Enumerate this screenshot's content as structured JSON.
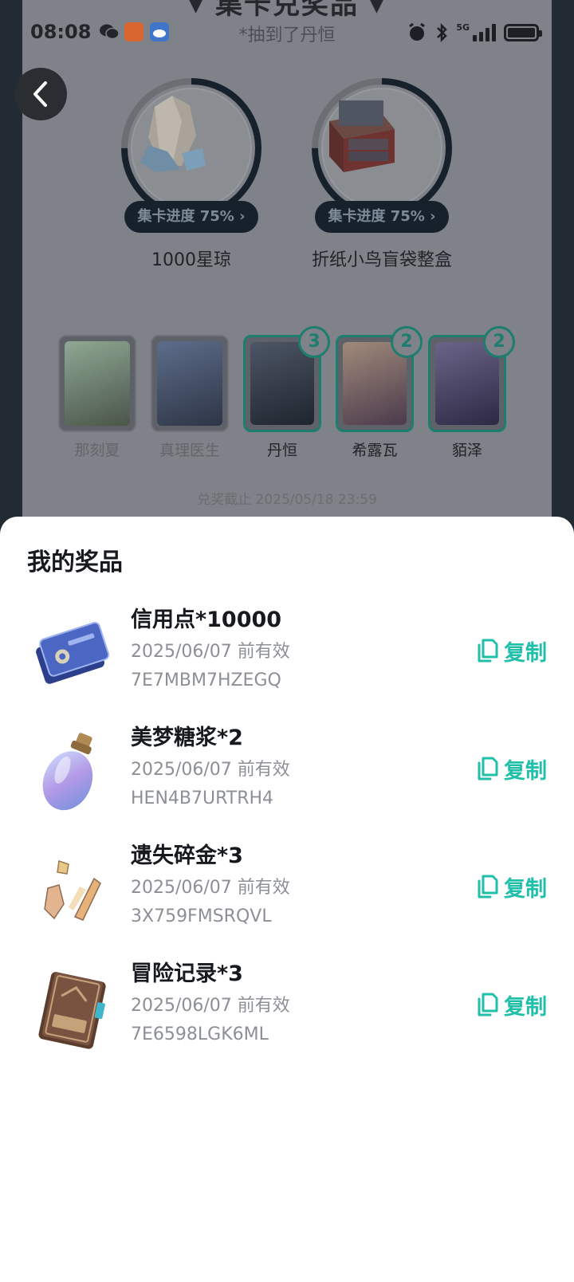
{
  "status_bar": {
    "time": "08:08",
    "notice": "*抽到了丹恒",
    "network": "5G"
  },
  "background": {
    "header_title": "集卡兑奖品",
    "prizes": [
      {
        "name": "1000星琼",
        "progress_label": "集卡进度 75%",
        "progress": 0.75
      },
      {
        "name": "折纸小鸟盲袋整盒",
        "progress_label": "集卡进度 75%",
        "progress": 0.75
      }
    ],
    "characters": [
      {
        "name": "那刻夏",
        "owned": false,
        "count": "",
        "color": "#6f8a78"
      },
      {
        "name": "真理医生",
        "owned": false,
        "count": "",
        "color": "#4a5c78"
      },
      {
        "name": "丹恒",
        "owned": true,
        "count": "3",
        "color": "#3a4453"
      },
      {
        "name": "希露瓦",
        "owned": true,
        "count": "2",
        "color": "#8a6d74"
      },
      {
        "name": "貊泽",
        "owned": true,
        "count": "2",
        "color": "#4c4a6e"
      }
    ],
    "deadline": "兑奖截止 2025/05/18 23:59"
  },
  "sheet": {
    "title": "我的奖品",
    "copy_label": "复制",
    "items": [
      {
        "title": "信用点*10000",
        "valid": "2025/06/07 前有效",
        "code": "7E7MBM7HZEGQ",
        "icon": "credit-card-icon"
      },
      {
        "title": "美梦糖浆*2",
        "valid": "2025/06/07 前有效",
        "code": "HEN4B7URTRH4",
        "icon": "syrup-bottle-icon"
      },
      {
        "title": "遗失碎金*3",
        "valid": "2025/06/07 前有效",
        "code": "3X759FMSRQVL",
        "icon": "gold-shards-icon"
      },
      {
        "title": "冒险记录*3",
        "valid": "2025/06/07 前有效",
        "code": "7E6598LGK6ML",
        "icon": "adventure-book-icon"
      }
    ]
  },
  "colors": {
    "accent": "#1fbfa9",
    "owned_border": "#1d7d6f",
    "sheet_bg": "#ffffff",
    "dim_bg": "#7f8288"
  }
}
